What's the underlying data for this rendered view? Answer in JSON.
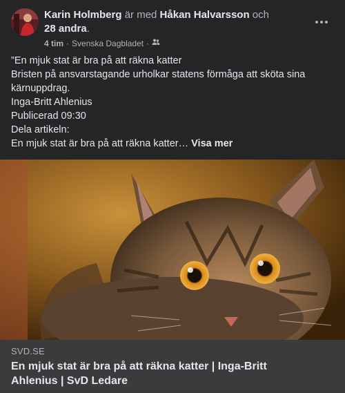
{
  "post": {
    "author": "Karin Holmberg",
    "with_text": "är med",
    "tagged": "Håkan Halvarsson",
    "and_text": "och",
    "others": "28 andra",
    "period": ".",
    "time": "4 tim",
    "separator": "·",
    "source": "Svenska Dagbladet",
    "audience_icon": "friends-icon",
    "more_icon": "more-options-icon"
  },
  "body": {
    "lines": [
      "”En mjuk stat är bra på att räkna katter",
      "Bristen på ansvarstagande urholkar statens förmåga att sköta sina kärnuppdrag.",
      "Inga-Britt Ahlenius",
      "Publicerad 09:30",
      "Dela artikeln:"
    ],
    "last_line": "En mjuk stat är bra på att räkna katter…",
    "see_more": "Visa mer"
  },
  "link": {
    "domain": "SVD.SE",
    "title": "En mjuk stat är bra på att räkna katter | Inga-Britt Ahlenius | SvD Ledare"
  },
  "colors": {
    "background": "#242526",
    "link_box": "#3a3b3c",
    "text_primary": "#e4e6eb",
    "text_secondary": "#b0b3b8"
  }
}
